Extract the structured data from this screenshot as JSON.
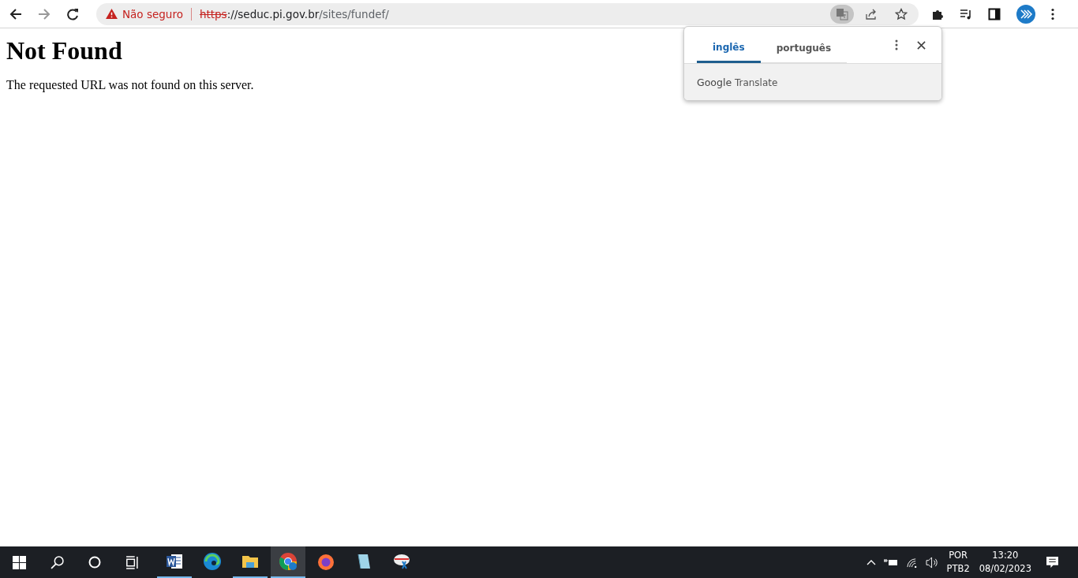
{
  "toolbar": {
    "security_label": "Não seguro",
    "url": {
      "scheme": "https",
      "host": "://seduc.pi.gov.br",
      "path": "/sites/fundef/"
    },
    "translate_active": true
  },
  "page": {
    "heading": "Not Found",
    "message": "The requested URL was not found on this server."
  },
  "translate_popup": {
    "tabs": [
      {
        "label": "inglês",
        "selected": true
      },
      {
        "label": "português",
        "selected": false
      }
    ],
    "brand": "Google",
    "product": "Translate"
  },
  "taskbar": {
    "apps": [
      {
        "kind": "word",
        "running": true,
        "selected": false
      },
      {
        "kind": "edge",
        "running": false,
        "selected": false
      },
      {
        "kind": "files",
        "running": true,
        "selected": false
      },
      {
        "kind": "chrome",
        "running": true,
        "selected": true
      },
      {
        "kind": "firefox",
        "running": false,
        "selected": false
      },
      {
        "kind": "notepad",
        "running": false,
        "selected": false
      },
      {
        "kind": "snipping",
        "running": false,
        "selected": false
      }
    ],
    "language": "POR",
    "layout": "PTB2",
    "time": "13:20",
    "date": "08/02/2023"
  }
}
